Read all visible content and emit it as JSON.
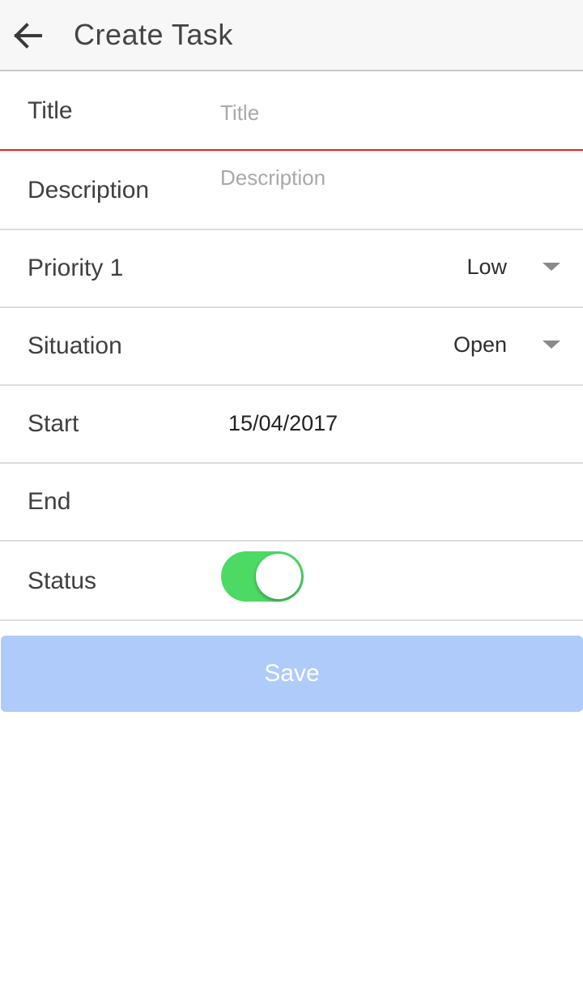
{
  "appbar": {
    "title": "Create Task",
    "back_icon": "arrow-left-icon"
  },
  "form": {
    "title": {
      "label": "Title",
      "placeholder": "Title",
      "value": ""
    },
    "description": {
      "label": "Description",
      "placeholder": "Description",
      "value": ""
    },
    "priority": {
      "label": "Priority 1",
      "selected": "Low"
    },
    "situation": {
      "label": "Situation",
      "selected": "Open"
    },
    "start": {
      "label": "Start",
      "value": "15/04/2017"
    },
    "end": {
      "label": "End",
      "value": ""
    },
    "status": {
      "label": "Status",
      "on": true
    }
  },
  "actions": {
    "save_label": "Save"
  },
  "colors": {
    "toggle_on": "#4cd964",
    "save_button": "#aecbf9",
    "error_underline": "#e02020",
    "appbar_bg": "#f7f7f7"
  }
}
